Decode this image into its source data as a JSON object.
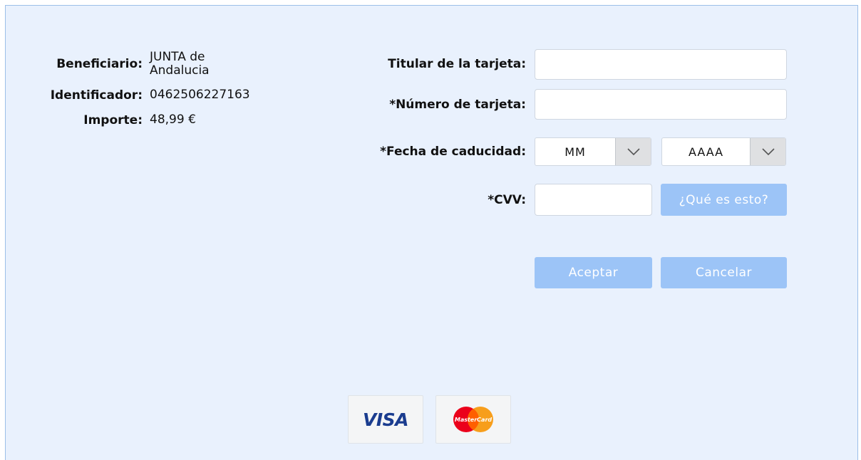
{
  "merchant": {
    "beneficiary_label": "Beneficiario:",
    "beneficiary_value": "JUNTA de Andalucia",
    "identifier_label": "Identificador:",
    "identifier_value": "0462506227163",
    "amount_label": "Importe:",
    "amount_value": "48,99 €"
  },
  "form": {
    "cardholder_label": "Titular de la tarjeta:",
    "cardholder_value": "",
    "card_number_label": "*Número de tarjeta:",
    "card_number_value": "",
    "expiry_label": "*Fecha de caducidad:",
    "expiry_month": "MM",
    "expiry_year": "AAAA",
    "cvv_label": "*CVV:",
    "cvv_value": "",
    "cvv_help_button": "¿Qué es esto?"
  },
  "actions": {
    "accept": "Aceptar",
    "cancel": "Cancelar"
  },
  "cards": {
    "visa_logo_text": "VISA",
    "mastercard_logo_text": "MasterCard"
  },
  "colors": {
    "panel_background": "#e9f1fd",
    "panel_border": "#9cbfe8",
    "button_background": "#9cc4f7",
    "visa_blue": "#1a3c8f",
    "mastercard_red": "#eb001b",
    "mastercard_orange": "#f79e1b"
  },
  "icons": {
    "select_arrow": "chevron-down-icon",
    "visa": "visa-logo-icon",
    "mastercard": "mastercard-logo-icon"
  }
}
